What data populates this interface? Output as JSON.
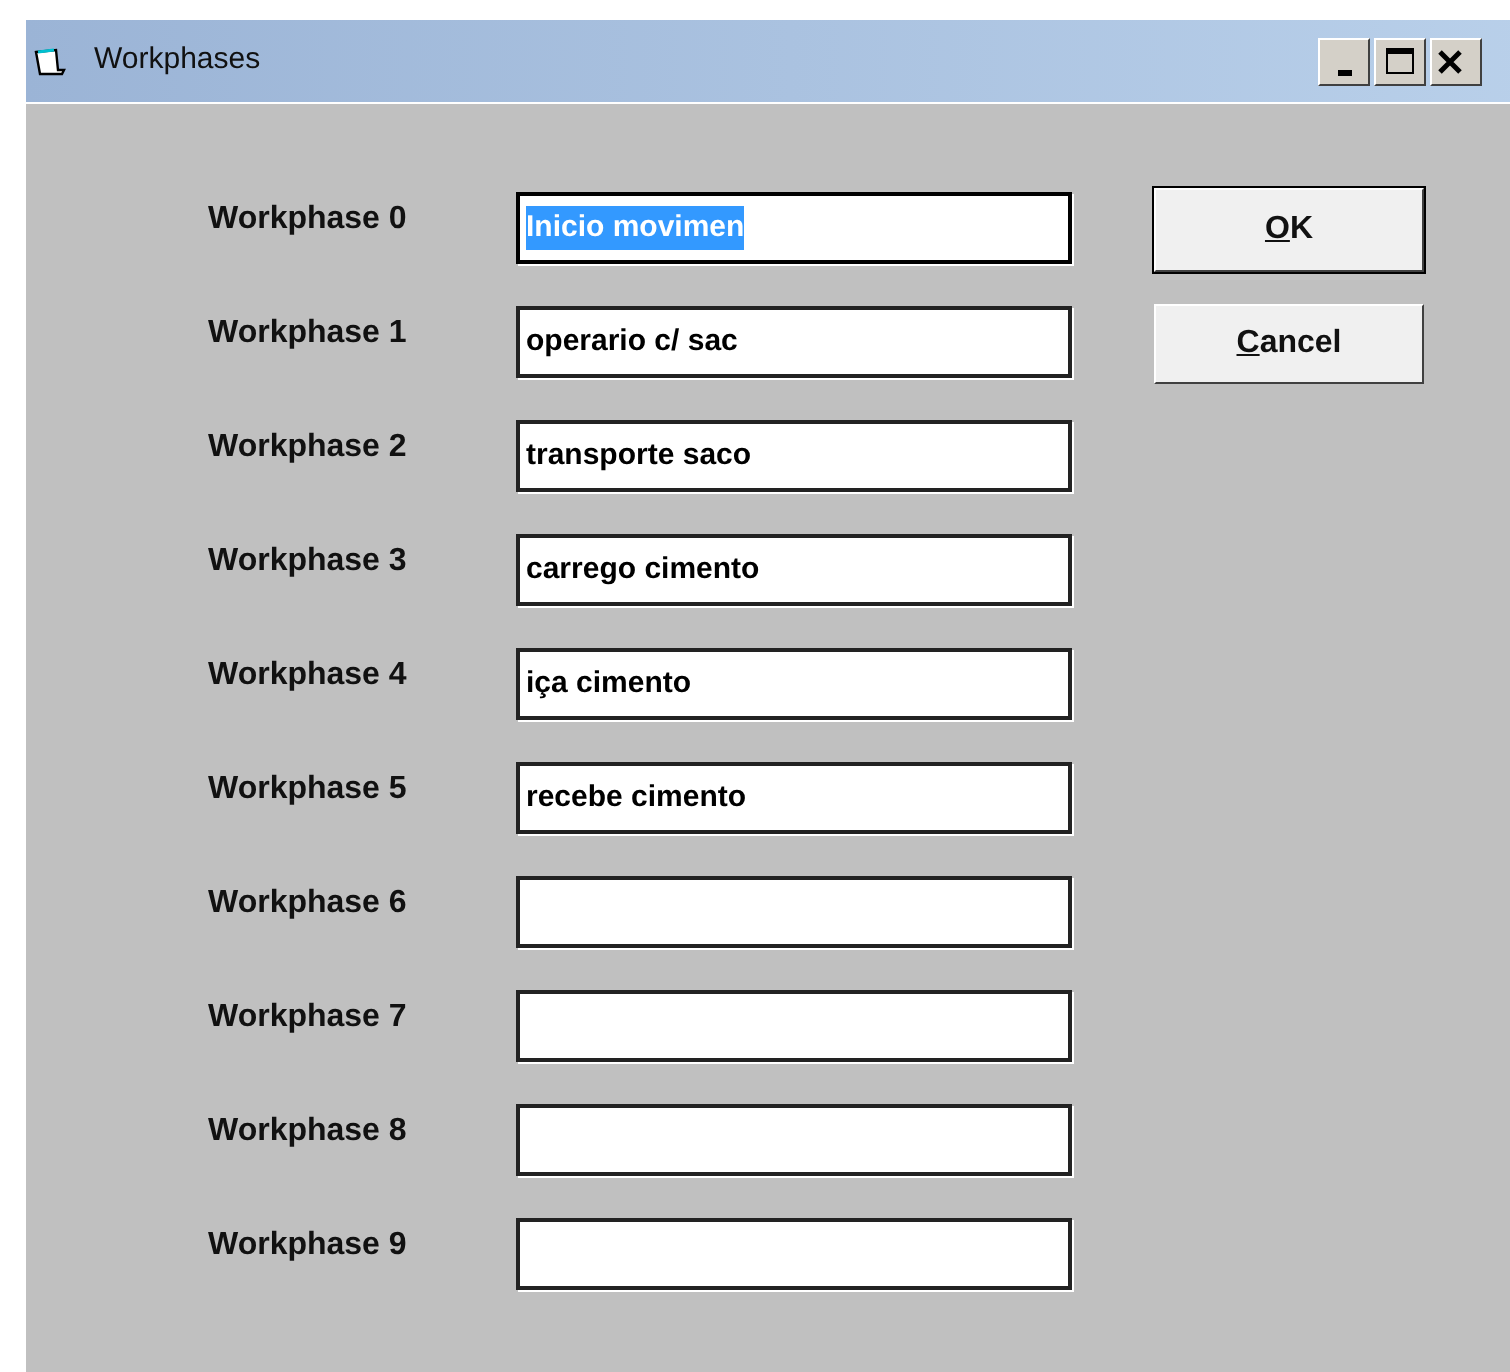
{
  "window": {
    "title": "Workphases"
  },
  "rows": [
    {
      "label": "Workphase 0",
      "value": "Inicio movimen",
      "text_selected": true
    },
    {
      "label": "Workphase 1",
      "value": "operario c/ sac",
      "text_selected": false
    },
    {
      "label": "Workphase 2",
      "value": "transporte saco",
      "text_selected": false
    },
    {
      "label": "Workphase 3",
      "value": "carrego cimento",
      "text_selected": false
    },
    {
      "label": "Workphase 4",
      "value": "iça cimento",
      "text_selected": false
    },
    {
      "label": "Workphase 5",
      "value": "recebe cimento",
      "text_selected": false
    },
    {
      "label": "Workphase 6",
      "value": "",
      "text_selected": false
    },
    {
      "label": "Workphase 7",
      "value": "",
      "text_selected": false
    },
    {
      "label": "Workphase 8",
      "value": "",
      "text_selected": false
    },
    {
      "label": "Workphase 9",
      "value": "",
      "text_selected": false
    }
  ],
  "buttons": [
    {
      "label": "OK",
      "default": true
    },
    {
      "label": "Cancel",
      "default": false
    }
  ]
}
